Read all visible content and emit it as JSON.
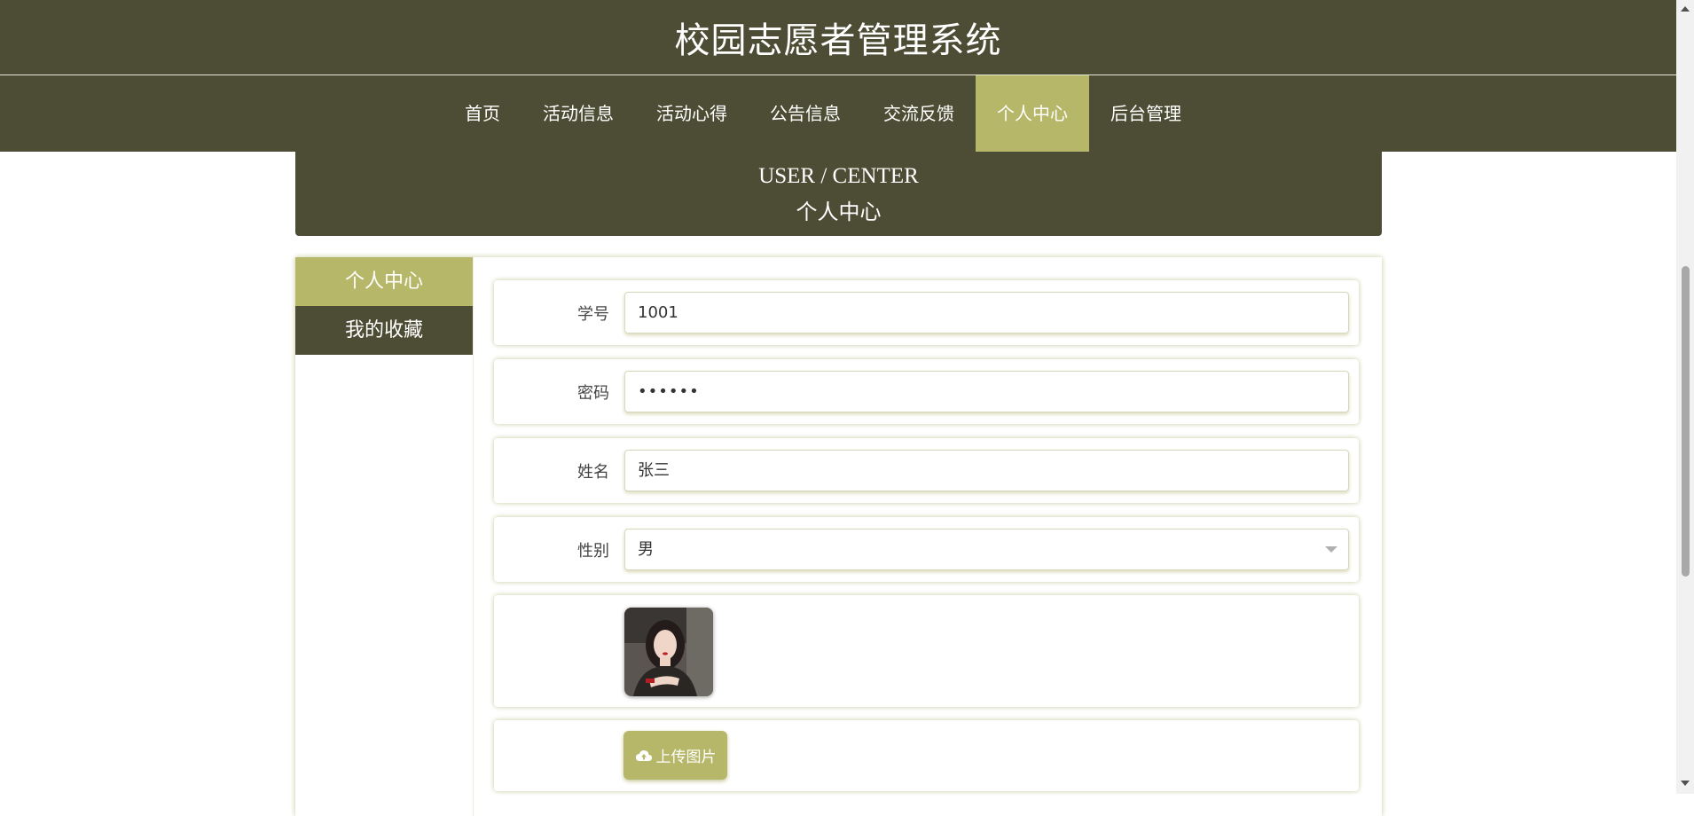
{
  "header": {
    "title": "校园志愿者管理系统"
  },
  "nav": {
    "items": [
      {
        "label": "首页"
      },
      {
        "label": "活动信息"
      },
      {
        "label": "活动心得"
      },
      {
        "label": "公告信息"
      },
      {
        "label": "交流反馈"
      },
      {
        "label": "个人中心",
        "active": true
      },
      {
        "label": "后台管理"
      }
    ]
  },
  "banner": {
    "title_en": "USER / CENTER",
    "title_cn": "个人中心"
  },
  "side_menu": {
    "items": [
      {
        "label": "个人中心",
        "active": true
      },
      {
        "label": "我的收藏"
      }
    ]
  },
  "form": {
    "student_id": {
      "label": "学号",
      "value": "1001"
    },
    "password": {
      "label": "密码",
      "value": "••••••"
    },
    "name": {
      "label": "姓名",
      "value": "张三"
    },
    "gender": {
      "label": "性别",
      "value": "男"
    },
    "avatar_icon": "avatar-photo",
    "upload": {
      "label": "上传图片",
      "icon": "cloud-upload-icon"
    }
  },
  "colors": {
    "primary": "#4d4d35",
    "accent": "#b7b769"
  }
}
